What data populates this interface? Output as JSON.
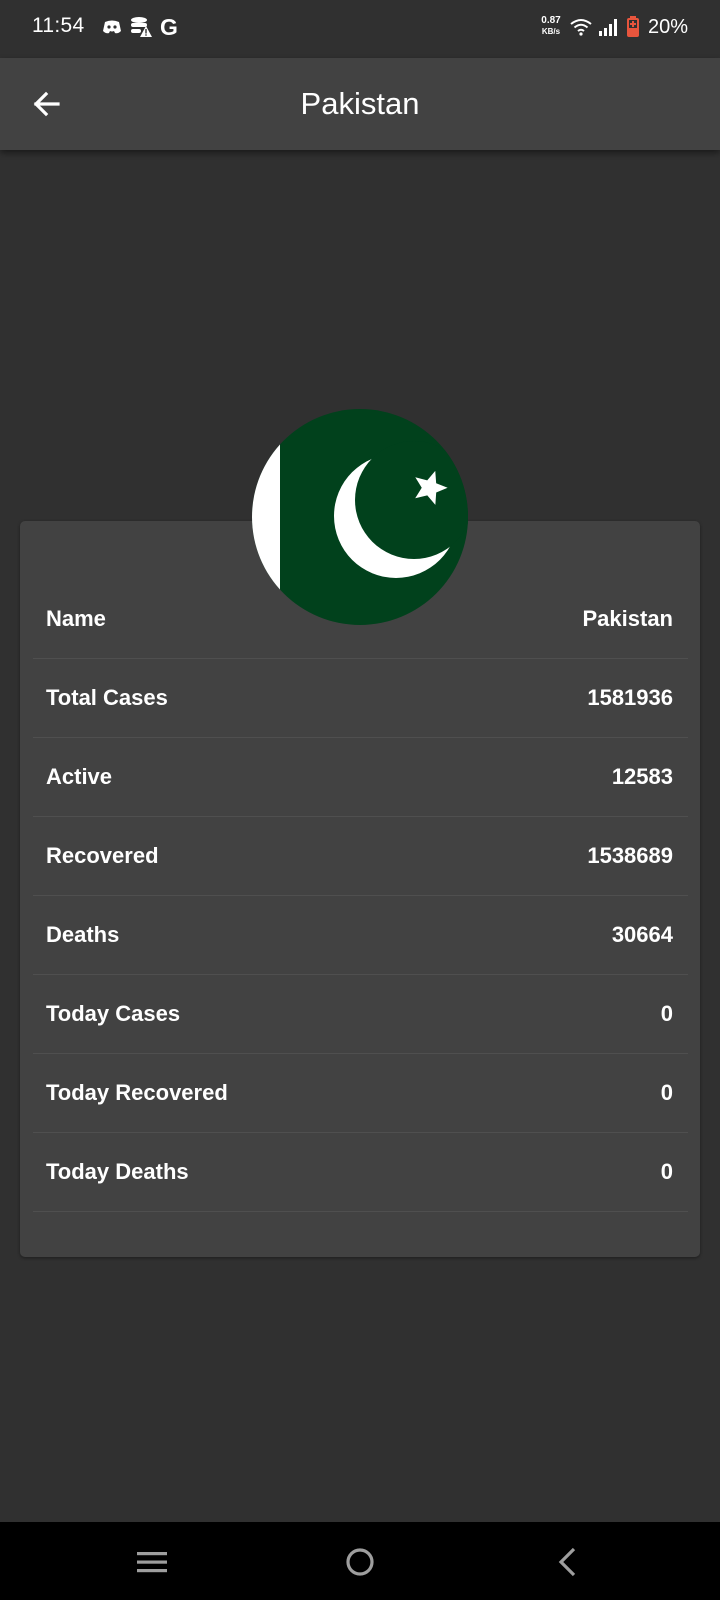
{
  "status_bar": {
    "time": "11:54",
    "left_icons": [
      "discord-icon",
      "stack-alert-icon",
      "google-icon"
    ],
    "google_letter": "G",
    "net_speed_value": "0.87",
    "net_speed_unit": "KB/s",
    "right_icons": [
      "wifi-icon",
      "signal-icon",
      "battery-icon"
    ],
    "battery_percent": "20%",
    "battery_color": "#e8553d"
  },
  "app_bar": {
    "back_icon": "arrow-left-icon",
    "title": "Pakistan"
  },
  "flag": {
    "icon": "pakistan-flag",
    "green": "#01411c",
    "white": "#ffffff"
  },
  "stats": [
    {
      "label": "Name",
      "value": "Pakistan"
    },
    {
      "label": "Total Cases",
      "value": "1581936"
    },
    {
      "label": "Active",
      "value": "12583"
    },
    {
      "label": "Recovered",
      "value": "1538689"
    },
    {
      "label": "Deaths",
      "value": "30664"
    },
    {
      "label": "Today Cases",
      "value": "0"
    },
    {
      "label": "Today Recovered",
      "value": "0"
    },
    {
      "label": "Today Deaths",
      "value": "0"
    }
  ],
  "nav_bar": {
    "buttons": [
      "menu-icon",
      "home-circle-icon",
      "back-chevron-icon"
    ]
  }
}
